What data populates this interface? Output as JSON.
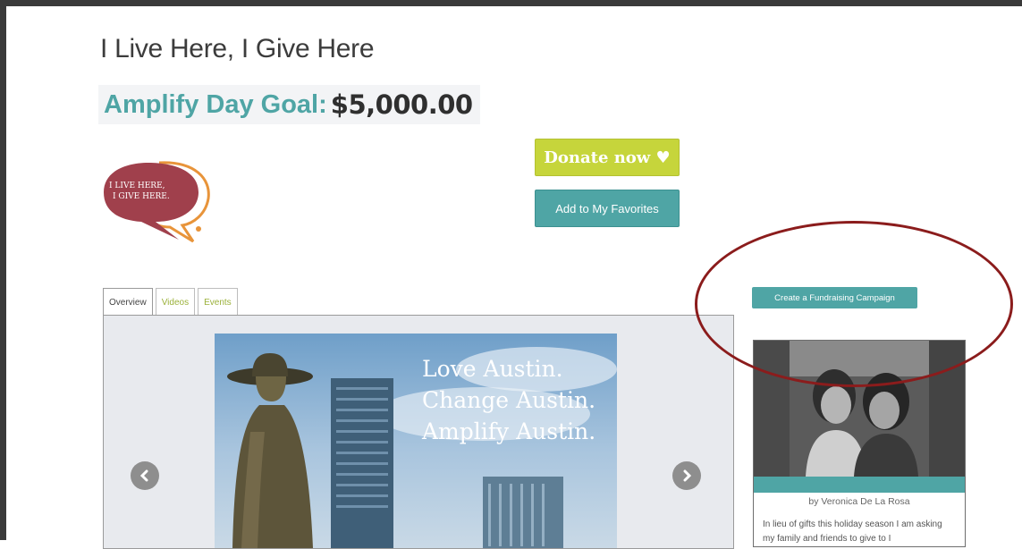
{
  "page": {
    "title": "I Live Here, I Give Here",
    "goal_label": "Amplify Day Goal:",
    "goal_amount": "$5,000.00"
  },
  "logo": {
    "line1": "I LIVE HERE,",
    "line2": "I GIVE HERE."
  },
  "actions": {
    "donate_label": "Donate now ♥",
    "favorites_label": "Add to My Favorites",
    "campaign_label": "Create a Fundraising Campaign"
  },
  "tabs": [
    {
      "label": "Overview"
    },
    {
      "label": "Videos"
    },
    {
      "label": "Events"
    }
  ],
  "hero": {
    "line1": "Love Austin.",
    "line2": "Change Austin.",
    "line3": "Amplify Austin.",
    "prev_icon": "chevron-left-icon",
    "next_icon": "chevron-right-icon"
  },
  "campaign_card": {
    "author": "by Veronica De La Rosa",
    "text": "In lieu of gifts this holiday season I am asking my family and friends to give to I"
  },
  "colors": {
    "teal": "#4fa5a5",
    "lime": "#c6d53b",
    "logo_red": "#a0404c",
    "annotation": "#8b1c1c"
  }
}
